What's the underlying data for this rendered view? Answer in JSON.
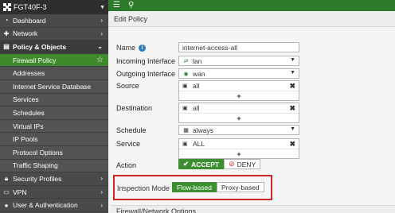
{
  "sidebar": {
    "hostname": "FGT40F-3",
    "items": [
      {
        "label": "Dashboard",
        "icon": "dashboard-icon"
      },
      {
        "label": "Network",
        "icon": "network-icon"
      },
      {
        "label": "Policy & Objects",
        "icon": "policy-icon"
      },
      {
        "label": "Firewall Policy"
      },
      {
        "label": "Addresses"
      },
      {
        "label": "Internet Service Database"
      },
      {
        "label": "Services"
      },
      {
        "label": "Schedules"
      },
      {
        "label": "Virtual IPs"
      },
      {
        "label": "IP Pools"
      },
      {
        "label": "Protocol Options"
      },
      {
        "label": "Traffic Shaping"
      },
      {
        "label": "Security Profiles",
        "icon": "lock-icon"
      },
      {
        "label": "VPN",
        "icon": "vpn-icon"
      },
      {
        "label": "User & Authentication",
        "icon": "user-icon"
      }
    ]
  },
  "topbar": {
    "menu_icon": "hamburger-icon",
    "search_icon": "search-icon"
  },
  "page": {
    "title": "Edit Policy"
  },
  "form": {
    "name_label": "Name",
    "name_value": "internet-access-all",
    "incoming_label": "Incoming Interface",
    "incoming_value": "lan",
    "outgoing_label": "Outgoing Interface",
    "outgoing_value": "wan",
    "source_label": "Source",
    "source_value": "all",
    "destination_label": "Destination",
    "destination_value": "all",
    "schedule_label": "Schedule",
    "schedule_value": "always",
    "service_label": "Service",
    "service_value": "ALL",
    "action_label": "Action",
    "accept_label": "ACCEPT",
    "deny_label": "DENY",
    "inspection_label": "Inspection Mode",
    "flow_label": "Flow-based",
    "proxy_label": "Proxy-based",
    "plus": "+"
  },
  "sections": {
    "firewall_options": "Firewall/Network Options"
  },
  "colors": {
    "accent_green": "#3b8f2f",
    "topbar_green": "#2d7b2a",
    "highlight_red": "#d32828"
  }
}
